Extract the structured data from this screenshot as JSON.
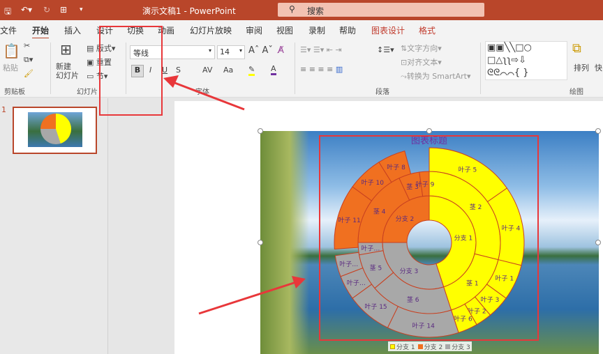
{
  "titlebar": {
    "doc_title": "演示文稿1 - PowerPoint",
    "search_placeholder": "搜索",
    "icons": [
      "save-icon",
      "undo-icon",
      "redo-icon",
      "present-icon",
      "customize-icon"
    ]
  },
  "tabs": [
    {
      "label": "文件"
    },
    {
      "label": "开始",
      "active": true
    },
    {
      "label": "插入"
    },
    {
      "label": "设计"
    },
    {
      "label": "切换"
    },
    {
      "label": "动画"
    },
    {
      "label": "幻灯片放映"
    },
    {
      "label": "审阅"
    },
    {
      "label": "视图"
    },
    {
      "label": "录制"
    },
    {
      "label": "帮助"
    },
    {
      "label": "图表设计",
      "contextual": true
    },
    {
      "label": "格式",
      "contextual": true
    }
  ],
  "ribbon": {
    "clipboard": {
      "paste": "粘贴",
      "group": "剪贴板"
    },
    "slides": {
      "new_slide": "新建\n幻灯片",
      "layout": "版式",
      "reset": "重置",
      "section": "节",
      "group": "幻灯片"
    },
    "font": {
      "name": "等线",
      "size": "14",
      "bold": "B",
      "italic": "I",
      "underline": "U",
      "strike": "S",
      "spacing": "AV",
      "case": "Aa",
      "color": "A",
      "group": "字体"
    },
    "paragraph": {
      "text_direction": "文字方向",
      "align_text": "对齐文本",
      "smartart": "转换为 SmartArt",
      "group": "段落"
    },
    "drawing": {
      "arrange": "排列",
      "quick": "快",
      "group": "绘图"
    }
  },
  "slide_pane": {
    "slide_number": "1"
  },
  "chart": {
    "title": "图表标题",
    "colors": {
      "分支1": "#ffff00",
      "分支2": "#f07020",
      "分支3": "#a8a8a8"
    },
    "legend": [
      "分支 1",
      "分支 2",
      "分支 3"
    ],
    "nodes": [
      {
        "label": "分支 1",
        "level": 1,
        "start": 0,
        "value": 162,
        "color": "#ffff00"
      },
      {
        "label": "茎 2",
        "level": 2,
        "start": 0,
        "value": 104,
        "color": "#ffff00"
      },
      {
        "label": "叶子 5",
        "level": 3,
        "start": 0,
        "value": 55,
        "color": "#ffff00"
      },
      {
        "label": "叶子 4",
        "level": 3,
        "start": 55,
        "value": 49,
        "color": "#ffff00"
      },
      {
        "label": "茎 1",
        "level": 2,
        "start": 104,
        "value": 58,
        "color": "#ffff00"
      },
      {
        "label": "叶子 1",
        "level": 3,
        "start": 104,
        "value": 22,
        "color": "#ffff00"
      },
      {
        "label": "叶子 3",
        "level": 3,
        "start": 126,
        "value": 14,
        "color": "#ffff00"
      },
      {
        "label": "叶子 2",
        "level": 3,
        "start": 140,
        "value": 10,
        "color": "#ffff00"
      },
      {
        "label": "叶子 6",
        "level": 3,
        "start": 150,
        "value": 12,
        "color": "#ffff00"
      },
      {
        "label": "分支 3",
        "level": 1,
        "start": 162,
        "value": 108,
        "color": "#a8a8a8"
      },
      {
        "label": "茎 6",
        "level": 2,
        "start": 162,
        "value": 68,
        "color": "#a8a8a8"
      },
      {
        "label": "茎 5",
        "level": 2,
        "start": 230,
        "value": 30,
        "color": "#a8a8a8"
      },
      {
        "label": "叶子…",
        "level": 2,
        "start": 260,
        "value": 10,
        "color": "#a8a8a8"
      },
      {
        "label": "叶子 14",
        "level": 3,
        "start": 162,
        "value": 44,
        "color": "#a8a8a8"
      },
      {
        "label": "叶子 15",
        "level": 3,
        "start": 206,
        "value": 28,
        "color": "#a8a8a8"
      },
      {
        "label": "叶子…",
        "level": 3,
        "start": 234,
        "value": 15,
        "color": "#a8a8a8"
      },
      {
        "label": "叶子…",
        "level": 3,
        "start": 249,
        "value": 13,
        "color": "#a8a8a8"
      },
      {
        "label": "分支 2",
        "level": 1,
        "start": 270,
        "value": 90,
        "color": "#f07020"
      },
      {
        "label": "茎 4",
        "level": 2,
        "start": 270,
        "value": 65,
        "color": "#f07020"
      },
      {
        "label": "茎 3",
        "level": 2,
        "start": 335,
        "value": 17,
        "color": "#f07020"
      },
      {
        "label": "叶子 9",
        "level": 2,
        "start": 352,
        "value": 8,
        "color": "#f07020"
      },
      {
        "label": "叶子 11",
        "level": 3,
        "start": 266,
        "value": 40,
        "color": "#f07020"
      },
      {
        "label": "叶子 10",
        "level": 3,
        "start": 306,
        "value": 22,
        "color": "#f07020"
      },
      {
        "label": "叶子 8",
        "level": 3,
        "start": 328,
        "value": 17,
        "color": "#f07020"
      }
    ]
  }
}
